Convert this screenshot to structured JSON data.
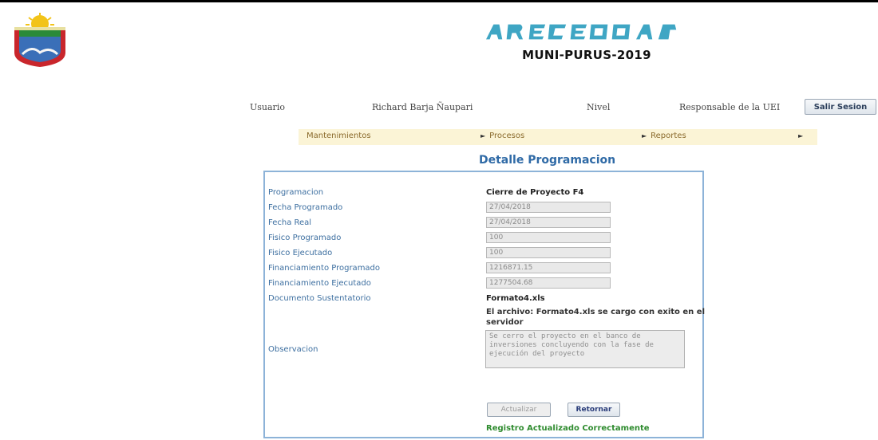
{
  "header": {
    "brand_subtitle": "MUNI-PURUS-2019",
    "logo_icon": "municipal-crest-icon",
    "brand_wordmark_icon": "brand-wordmark-icon"
  },
  "userbar": {
    "user_label": "Usuario",
    "user_name": "Richard Barja Ñaupari",
    "level_label": "Nivel",
    "level_value": "Responsable de la UEI",
    "logout_label": "Salir Sesion"
  },
  "menu": {
    "items": [
      {
        "label": "Mantenimientos"
      },
      {
        "label": "Procesos"
      },
      {
        "label": "Reportes"
      }
    ],
    "background": "#fbf4d6"
  },
  "page": {
    "title": "Detalle Programacion"
  },
  "form": {
    "programacion_label": "Programacion",
    "programacion_value": "Cierre de Proyecto F4",
    "fecha_programado_label": "Fecha Programado",
    "fecha_programado_value": "27/04/2018",
    "fecha_real_label": "Fecha Real",
    "fecha_real_value": "27/04/2018",
    "fisico_programado_label": "Fisico Programado",
    "fisico_programado_value": "100",
    "fisico_ejecutado_label": "Fisico Ejecutado",
    "fisico_ejecutado_value": "100",
    "fin_programado_label": "Financiamiento Programado",
    "fin_programado_value": "1216871.15",
    "fin_ejecutado_label": "Financiamiento Ejecutado",
    "fin_ejecutado_value": "1277504.68",
    "documento_label": "Documento Sustentatorio",
    "documento_value": "Formato4.xls",
    "upload_message": "El archivo: Formato4.xls se cargo con exito en el servidor",
    "observacion_label": "Observacion",
    "observacion_value": "Se cerro el proyecto en el banco de inversiones concluyendo con la fase de ejecución del proyecto",
    "update_button": "Actualizar",
    "return_button": "Retornar",
    "success_message": "Registro Actualizado Correctamente"
  },
  "colors": {
    "label_blue": "#3d6fa0",
    "title_blue": "#2f6aa6",
    "panel_border": "#8db3d8",
    "success_green": "#2e8b2e",
    "menu_text": "#8a6a2c"
  }
}
